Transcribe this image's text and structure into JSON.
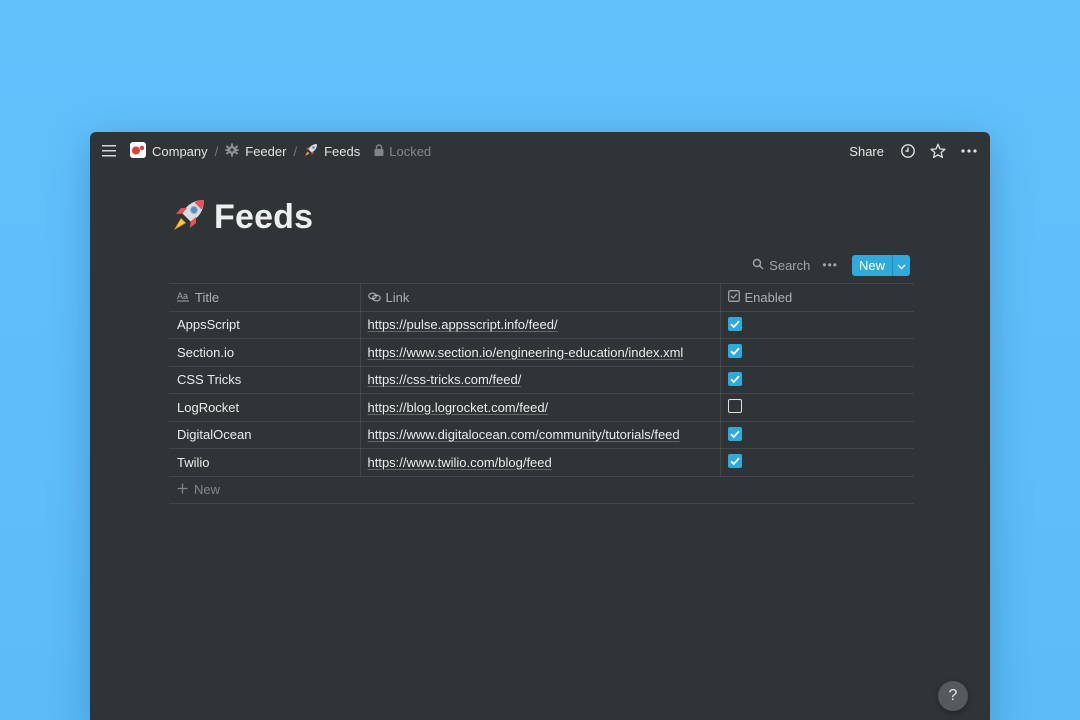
{
  "breadcrumb": {
    "items": [
      {
        "label": "Company",
        "icon": "company-logo-icon"
      },
      {
        "label": "Feeder",
        "icon": "gear-icon"
      },
      {
        "label": "Feeds",
        "icon": "rocket-icon"
      }
    ],
    "separator": "/",
    "locked_label": "Locked"
  },
  "topbar": {
    "share_label": "Share",
    "icons": [
      "history-icon",
      "star-icon",
      "more-icon"
    ]
  },
  "page": {
    "title": "Feeds",
    "icon": "rocket-icon"
  },
  "database": {
    "search_label": "Search",
    "more_label": "•••",
    "new_label": "New",
    "columns": [
      {
        "label": "Title",
        "icon": "text-type-icon"
      },
      {
        "label": "Link",
        "icon": "link-icon"
      },
      {
        "label": "Enabled",
        "icon": "checkbox-icon"
      }
    ],
    "rows": [
      {
        "title": "AppsScript",
        "link": "https://pulse.appsscript.info/feed/",
        "enabled": true
      },
      {
        "title": "Section.io",
        "link": "https://www.section.io/engineering-education/index.xml",
        "enabled": true
      },
      {
        "title": "CSS Tricks",
        "link": "https://css-tricks.com/feed/",
        "enabled": true
      },
      {
        "title": "LogRocket",
        "link": "https://blog.logrocket.com/feed/",
        "enabled": false
      },
      {
        "title": "DigitalOcean",
        "link": "https://www.digitalocean.com/community/tutorials/feed",
        "enabled": true
      },
      {
        "title": "Twilio",
        "link": "https://www.twilio.com/blog/feed",
        "enabled": true
      }
    ],
    "add_row_label": "New"
  },
  "help": {
    "label": "?"
  },
  "colors": {
    "background": "#5bbcf8",
    "window": "#2f3437",
    "accent": "#2eaadc",
    "company_logo": "#e03e3e"
  }
}
